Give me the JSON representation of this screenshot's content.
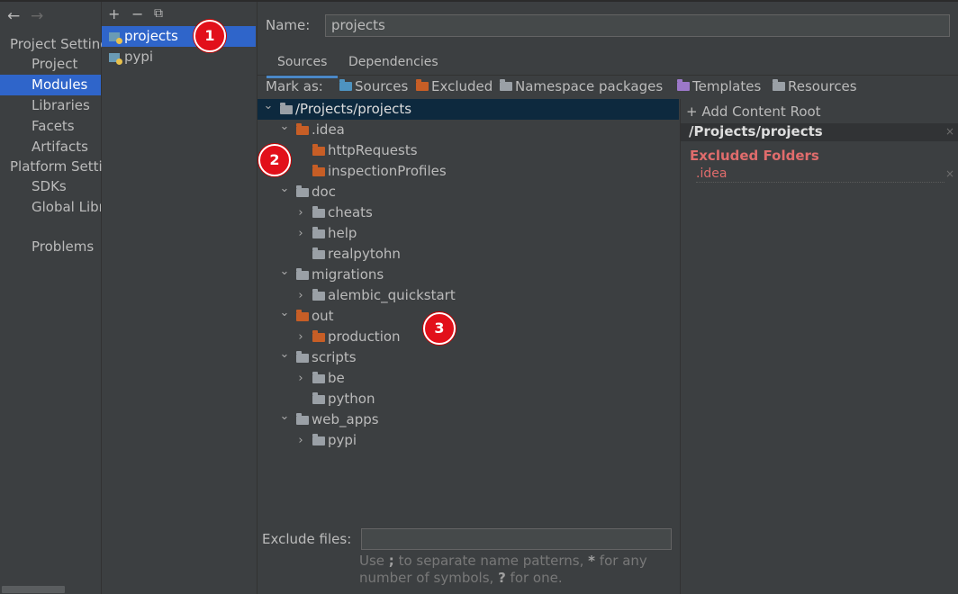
{
  "nav": {
    "back_arrow": "←",
    "forward_arrow": "→",
    "items": [
      {
        "label": "Project Settings",
        "kind": "head"
      },
      {
        "label": "Project",
        "kind": "sub"
      },
      {
        "label": "Modules",
        "kind": "sub",
        "selected": true
      },
      {
        "label": "Libraries",
        "kind": "sub"
      },
      {
        "label": "Facets",
        "kind": "sub"
      },
      {
        "label": "Artifacts",
        "kind": "sub"
      },
      {
        "label": "Platform Settings",
        "kind": "head"
      },
      {
        "label": "SDKs",
        "kind": "sub"
      },
      {
        "label": "Global Libraries",
        "kind": "sub"
      },
      {
        "label": "Problems",
        "kind": "sub"
      }
    ]
  },
  "modules": {
    "toolbar": {
      "add": "+",
      "remove": "−",
      "copy": "⧉"
    },
    "items": [
      {
        "label": "projects",
        "selected": true
      },
      {
        "label": "pypi"
      }
    ]
  },
  "name_field": {
    "label": "Name:",
    "value": "projects"
  },
  "tabs": [
    {
      "label": "Sources",
      "active": true
    },
    {
      "label": "Dependencies"
    }
  ],
  "mark_as": {
    "label": "Mark as:",
    "items": [
      {
        "label": "Sources",
        "color": "#4e93c0"
      },
      {
        "label": "Excluded",
        "color": "#c75e26"
      },
      {
        "label": "Namespace packages",
        "color": "#9aa0a6"
      },
      {
        "label": "Templates",
        "color": "#9c78c9"
      },
      {
        "label": "Resources",
        "color": "#9aa0a6"
      }
    ]
  },
  "tree": [
    {
      "label": "/Projects/projects",
      "depth": 0,
      "expanded": true,
      "folder": "grey",
      "selected": true
    },
    {
      "label": ".idea",
      "depth": 1,
      "expanded": true,
      "folder": "orange"
    },
    {
      "label": "httpRequests",
      "depth": 2,
      "folder": "orange"
    },
    {
      "label": "inspectionProfiles",
      "depth": 2,
      "folder": "orange"
    },
    {
      "label": "doc",
      "depth": 1,
      "expanded": true,
      "folder": "grey"
    },
    {
      "label": "cheats",
      "depth": 2,
      "expanded": false,
      "folder": "grey"
    },
    {
      "label": "help",
      "depth": 2,
      "expanded": false,
      "folder": "grey"
    },
    {
      "label": "realpytohn",
      "depth": 2,
      "folder": "grey"
    },
    {
      "label": "migrations",
      "depth": 1,
      "expanded": true,
      "folder": "grey"
    },
    {
      "label": "alembic_quickstart",
      "depth": 2,
      "expanded": false,
      "folder": "grey"
    },
    {
      "label": "out",
      "depth": 1,
      "expanded": true,
      "folder": "orange"
    },
    {
      "label": "production",
      "depth": 2,
      "expanded": false,
      "folder": "orange"
    },
    {
      "label": "scripts",
      "depth": 1,
      "expanded": true,
      "folder": "grey"
    },
    {
      "label": "be",
      "depth": 2,
      "expanded": false,
      "folder": "grey"
    },
    {
      "label": "python",
      "depth": 2,
      "folder": "grey"
    },
    {
      "label": "web_apps",
      "depth": 1,
      "expanded": true,
      "folder": "grey"
    },
    {
      "label": "pypi",
      "depth": 2,
      "expanded": false,
      "folder": "grey"
    }
  ],
  "content_roots": {
    "add_label": "+ Add Content Root",
    "root_path": "/Projects/projects",
    "excluded_header": "Excluded Folders",
    "excluded_items": [
      ".idea"
    ],
    "remove_glyph": "×"
  },
  "exclude_files": {
    "label": "Exclude files:",
    "value": "",
    "hint_line1_a": "Use ",
    "hint_line1_b": ";",
    "hint_line1_c": " to separate name patterns, ",
    "hint_line1_d": "*",
    "hint_line1_e": " for any",
    "hint_line2_a": "number of symbols, ",
    "hint_line2_b": "?",
    "hint_line2_c": " for one."
  },
  "badges": [
    "1",
    "2",
    "3"
  ],
  "colors": {
    "selection": "#2f65ca",
    "tree_selection": "#0d293e",
    "excluded_red": "#e06c6c",
    "badge_red": "#e2101a"
  }
}
